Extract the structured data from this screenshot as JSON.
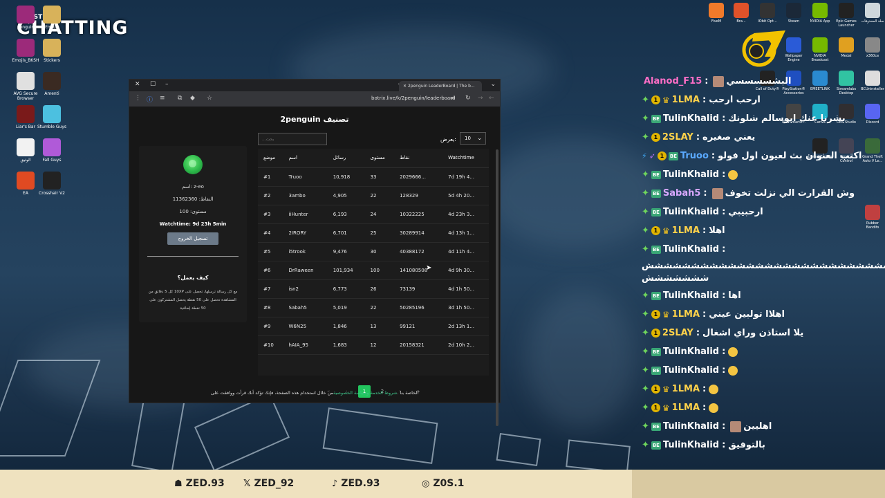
{
  "overlay": {
    "just": "JUST",
    "chatting": "CHATTING"
  },
  "desktop_icons": [
    {
      "label": "penguin",
      "icon": "rar-archive-icon",
      "color": "#9c2a7a"
    },
    {
      "label": "Emojis",
      "icon": "rar-archive-icon",
      "color": "#d8b25a"
    },
    {
      "label": "Emojis_BKSH",
      "icon": "rar-archive-icon",
      "color": "#9c2a7a"
    },
    {
      "label": "Stickers",
      "icon": "rar-archive-icon",
      "color": "#d8b25a"
    },
    {
      "label": "AVG Secure Browser",
      "icon": "avg-browser-icon",
      "color": "#e0e0e0"
    },
    {
      "label": "Amenti",
      "icon": "amenti-icon",
      "color": "#3a2a22"
    },
    {
      "label": "Liar's Bar",
      "icon": "liars-bar-icon",
      "color": "#7a1a1a"
    },
    {
      "label": "Stumble Guys",
      "icon": "stumble-guys-icon",
      "color": "#4cc0e0"
    },
    {
      "label": "الوثيق",
      "icon": "document-icon",
      "color": "#f2f2f2"
    },
    {
      "label": "Fall Guys",
      "icon": "fall-guys-icon",
      "color": "#b05ad8"
    },
    {
      "label": "EA",
      "icon": "ea-icon",
      "color": "#e04a22"
    },
    {
      "label": "Crosshair V2",
      "icon": "crosshair-icon",
      "color": "#222222"
    }
  ],
  "top_icons": [
    {
      "label": "FiveM",
      "icon": "fivem-icon",
      "color": "#f07a2a"
    },
    {
      "label": "Bra...",
      "icon": "brave-icon",
      "color": "#e0522a"
    },
    {
      "label": "IObit Opt...",
      "icon": "iobit-icon",
      "color": "#333"
    },
    {
      "label": "Steam",
      "icon": "steam-icon",
      "color": "#1b2838"
    },
    {
      "label": "NVIDIA App",
      "icon": "nvidia-icon",
      "color": "#76b900"
    },
    {
      "label": "Epic Games Launcher",
      "icon": "epic-icon",
      "color": "#222"
    },
    {
      "label": "سلة المحذوفات",
      "icon": "recycle-bin-icon",
      "color": "#cfd8dc"
    },
    {
      "label": "Wallpaper Engine",
      "icon": "wallpaper-engine-icon",
      "color": "#2a5bd7"
    },
    {
      "label": "NVIDIA Broadcast",
      "icon": "nvidia-broadcast-icon",
      "color": "#76b900"
    },
    {
      "label": "Medal",
      "icon": "medal-icon",
      "color": "#e0a020"
    },
    {
      "label": "x360ce",
      "icon": "gamepad-icon",
      "color": "#888"
    },
    {
      "label": "Call of Duty®",
      "icon": "cod-icon",
      "color": "#222"
    },
    {
      "label": "PlayStation® Accessories",
      "icon": "playstation-icon",
      "color": "#1f4fc0"
    },
    {
      "label": "EMEETLINK",
      "icon": "emeet-icon",
      "color": "#2a8ad0"
    },
    {
      "label": "Streamlabs Desktop",
      "icon": "streamlabs-icon",
      "color": "#31c3a2"
    },
    {
      "label": "BCUninstaller",
      "icon": "uninstaller-icon",
      "color": "#ddd"
    },
    {
      "label": "IPTVSmarte...",
      "icon": "iptv-icon",
      "color": "#444"
    },
    {
      "label": "Canva",
      "icon": "canva-icon",
      "color": "#20b0c8"
    },
    {
      "label": "OBS Studio",
      "icon": "obs-icon",
      "color": "#302e31"
    },
    {
      "label": "Discord",
      "icon": "discord-icon",
      "color": "#5865f2"
    },
    {
      "label": "Unreal Engine",
      "icon": "unreal-icon",
      "color": "#222"
    },
    {
      "label": "Ground Control",
      "icon": "ground-control-icon",
      "color": "#445"
    },
    {
      "label": "Grand Theft Auto V Le...",
      "icon": "gta-icon",
      "color": "#3a6a3a"
    },
    {
      "label": "Rubber Bandits",
      "icon": "rubber-bandits-icon",
      "color": "#c04040"
    }
  ],
  "browser": {
    "tab_title": "2penguin LeaderBoard | The b...",
    "url": "botrix.live/k/2penguin/leaderboard",
    "page_title": "2penguin تصنيف",
    "search_placeholder": "بحث...",
    "show_label": "يعرض:",
    "show_value": "10",
    "profile": {
      "name": "اسم: z-eo",
      "points": "النقاط: 11362360",
      "level": "مستوى: 100",
      "watchtime": "Watchtime: 9d 23h 5min",
      "logout": "تسجيل الخروج",
      "how_title": "كيف يعمل؟",
      "how_text": "مع كل رسالة ترسلها، تحصل على 10XP كل 5 دقائق من المشاهدة تحصل على 50 نقطة يحصل المشتركون على 50 نقطة إضافية"
    },
    "table": {
      "headers": [
        "موضع",
        "اسم",
        "رسائل",
        "مستوى",
        "نقاط",
        "Watchtime"
      ],
      "rows": [
        [
          "#1",
          "Truoo",
          "10,918",
          "33",
          "2029666...",
          "7d 19h 4..."
        ],
        [
          "#2",
          "3ambo",
          "4,905",
          "22",
          "128329",
          "5d 4h 20..."
        ],
        [
          "#3",
          "iiHunter",
          "6,193",
          "24",
          "10322225",
          "4d 23h 3..."
        ],
        [
          "#4",
          "2IRORY",
          "6,701",
          "25",
          "30289914",
          "4d 13h 1..."
        ],
        [
          "#5",
          "i5trook",
          "9,476",
          "30",
          "40388172",
          "4d 11h 4..."
        ],
        [
          "#6",
          "DrRaween",
          "101,934",
          "100",
          "141080508",
          "4d 9h 30..."
        ],
        [
          "#7",
          "isn2",
          "6,773",
          "26",
          "73139",
          "4d 1h 50..."
        ],
        [
          "#8",
          "Sabah5",
          "5,019",
          "22",
          "50285196",
          "3d 1h 50..."
        ],
        [
          "#9",
          "W6N25",
          "1,846",
          "13",
          "99121",
          "2d 13h 1..."
        ],
        [
          "#10",
          "hAIA_95",
          "1,683",
          "12",
          "20158321",
          "2d 10h 2..."
        ]
      ]
    },
    "pager": {
      "first": "«",
      "prev": "‹",
      "p1": "1",
      "p2": "2",
      "next": "›",
      "last": "»"
    },
    "footer_pre": "الخاصة بنا .",
    "footer_link": "شروط الخدمة وسياسة الخصوصية",
    "footer_post": "من خلال استخدام هذه الصفحة، فإنك تؤكد أنك قرأت ووافقت على"
  },
  "chat": [
    {
      "user": "Alanod_F15",
      "color": "#ff6ec7",
      "badges": [],
      "text": "البشسسسسي",
      "avatar": true
    },
    {
      "user": "1LMA",
      "color": "#ffd24a",
      "badges": [
        "diamond",
        "one",
        "crown"
      ],
      "text": "ارحب ارحب"
    },
    {
      "user": "TulinKhalid",
      "color": "#ffffff",
      "badges": [
        "diamond",
        "bot"
      ],
      "text": "بشرنا عنك ابوسالم شلونك"
    },
    {
      "user": "2SLAY",
      "color": "#ffd24a",
      "badges": [
        "diamond",
        "one"
      ],
      "text": "يعني صغيره"
    },
    {
      "user": "Truoo",
      "color": "#5aa9ff",
      "badges": [
        "bolt",
        "sword",
        "one",
        "bot"
      ],
      "text": "اكتب العنوان بث لعيون اول فولو"
    },
    {
      "user": "TulinKhalid",
      "color": "#ffffff",
      "badges": [
        "diamond",
        "bot"
      ],
      "text": "",
      "emoji": true
    },
    {
      "user": "Sabah5",
      "color": "#d8a8ff",
      "badges": [
        "diamond",
        "bot"
      ],
      "text": "وش القرارت الي نزلت تخوف",
      "avatar": true
    },
    {
      "user": "TulinKhalid",
      "color": "#ffffff",
      "badges": [
        "diamond",
        "bot"
      ],
      "text": "ارحبيبي"
    },
    {
      "user": "1LMA",
      "color": "#ffd24a",
      "badges": [
        "diamond",
        "one",
        "crown"
      ],
      "text": "اهلا"
    },
    {
      "user": "TulinKhalid",
      "color": "#ffffff",
      "badges": [
        "diamond",
        "bot"
      ],
      "text": ""
    }
  ],
  "chat_long_1": "ششششششششششششششششششششششششششششششششششششششششششششششششششششش",
  "chat_long_2": "ششششششش",
  "chat2": [
    {
      "user": "TulinKhalid",
      "color": "#ffffff",
      "badges": [
        "diamond",
        "bot"
      ],
      "text": "اها"
    },
    {
      "user": "1LMA",
      "color": "#ffd24a",
      "badges": [
        "diamond",
        "one",
        "crown"
      ],
      "text": "اهلاا تولبين عيني"
    },
    {
      "user": "2SLAY",
      "color": "#ffd24a",
      "badges": [
        "diamond",
        "one"
      ],
      "text": "يلا استاذن وراي اشغال"
    },
    {
      "user": "TulinKhalid",
      "color": "#ffffff",
      "badges": [
        "diamond",
        "bot"
      ],
      "text": "",
      "emoji": true
    },
    {
      "user": "TulinKhalid",
      "color": "#ffffff",
      "badges": [
        "diamond",
        "bot"
      ],
      "text": "",
      "emoji": true
    },
    {
      "user": "1LMA",
      "color": "#ffd24a",
      "badges": [
        "diamond",
        "one",
        "crown"
      ],
      "text": "",
      "emoji": true
    },
    {
      "user": "1LMA",
      "color": "#ffd24a",
      "badges": [
        "diamond",
        "one",
        "crown"
      ],
      "text": "",
      "emoji": true
    },
    {
      "user": "TulinKhalid",
      "color": "#ffffff",
      "badges": [
        "diamond",
        "bot"
      ],
      "text": "اهليين",
      "avatar": true
    },
    {
      "user": "TulinKhalid",
      "color": "#ffffff",
      "badges": [
        "diamond",
        "bot"
      ],
      "text": "بالتوفيق"
    }
  ],
  "socials": [
    {
      "icon": "snapchat-icon",
      "glyph": "☗",
      "handle": "ZED.93"
    },
    {
      "icon": "x-icon",
      "glyph": "𝕏",
      "handle": "ZED_92"
    },
    {
      "icon": "tiktok-icon",
      "glyph": "♪",
      "handle": "ZED.93"
    },
    {
      "icon": "instagram-icon",
      "glyph": "◎",
      "handle": "Z0S.1"
    }
  ]
}
